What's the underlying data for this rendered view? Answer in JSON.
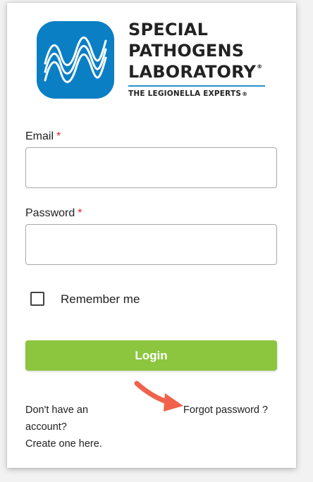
{
  "brand": {
    "line1": "SPECIAL",
    "line2": "PATHOGENS",
    "line3": "LABORATORY",
    "tagline": "THE LEGIONELLA EXPERTS",
    "registered_mark": "®",
    "logo_icon": "wave-logo-icon",
    "logo_color": "#0a7fc4"
  },
  "form": {
    "email_label": "Email",
    "email_value": "",
    "password_label": "Password",
    "password_value": "",
    "required_marker": "*",
    "remember_label": "Remember me",
    "remember_checked": false,
    "login_label": "Login",
    "login_color": "#8cc63f"
  },
  "footer": {
    "no_account_line1": "Don't have an",
    "no_account_line2": "account?",
    "create_link": "Create one here.",
    "forgot_link": "Forgot password ?"
  },
  "annotation": {
    "arrow_icon": "pointer-arrow-icon",
    "arrow_color": "#f0624b"
  }
}
